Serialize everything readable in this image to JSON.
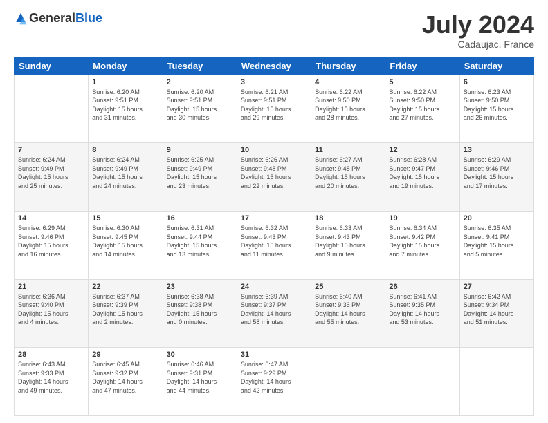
{
  "header": {
    "logo_general": "General",
    "logo_blue": "Blue",
    "month_title": "July 2024",
    "location": "Cadaujac, France"
  },
  "weekdays": [
    "Sunday",
    "Monday",
    "Tuesday",
    "Wednesday",
    "Thursday",
    "Friday",
    "Saturday"
  ],
  "weeks": [
    [
      {
        "day": "",
        "info": ""
      },
      {
        "day": "1",
        "info": "Sunrise: 6:20 AM\nSunset: 9:51 PM\nDaylight: 15 hours\nand 31 minutes."
      },
      {
        "day": "2",
        "info": "Sunrise: 6:20 AM\nSunset: 9:51 PM\nDaylight: 15 hours\nand 30 minutes."
      },
      {
        "day": "3",
        "info": "Sunrise: 6:21 AM\nSunset: 9:51 PM\nDaylight: 15 hours\nand 29 minutes."
      },
      {
        "day": "4",
        "info": "Sunrise: 6:22 AM\nSunset: 9:50 PM\nDaylight: 15 hours\nand 28 minutes."
      },
      {
        "day": "5",
        "info": "Sunrise: 6:22 AM\nSunset: 9:50 PM\nDaylight: 15 hours\nand 27 minutes."
      },
      {
        "day": "6",
        "info": "Sunrise: 6:23 AM\nSunset: 9:50 PM\nDaylight: 15 hours\nand 26 minutes."
      }
    ],
    [
      {
        "day": "7",
        "info": "Sunrise: 6:24 AM\nSunset: 9:49 PM\nDaylight: 15 hours\nand 25 minutes."
      },
      {
        "day": "8",
        "info": "Sunrise: 6:24 AM\nSunset: 9:49 PM\nDaylight: 15 hours\nand 24 minutes."
      },
      {
        "day": "9",
        "info": "Sunrise: 6:25 AM\nSunset: 9:49 PM\nDaylight: 15 hours\nand 23 minutes."
      },
      {
        "day": "10",
        "info": "Sunrise: 6:26 AM\nSunset: 9:48 PM\nDaylight: 15 hours\nand 22 minutes."
      },
      {
        "day": "11",
        "info": "Sunrise: 6:27 AM\nSunset: 9:48 PM\nDaylight: 15 hours\nand 20 minutes."
      },
      {
        "day": "12",
        "info": "Sunrise: 6:28 AM\nSunset: 9:47 PM\nDaylight: 15 hours\nand 19 minutes."
      },
      {
        "day": "13",
        "info": "Sunrise: 6:29 AM\nSunset: 9:46 PM\nDaylight: 15 hours\nand 17 minutes."
      }
    ],
    [
      {
        "day": "14",
        "info": "Sunrise: 6:29 AM\nSunset: 9:46 PM\nDaylight: 15 hours\nand 16 minutes."
      },
      {
        "day": "15",
        "info": "Sunrise: 6:30 AM\nSunset: 9:45 PM\nDaylight: 15 hours\nand 14 minutes."
      },
      {
        "day": "16",
        "info": "Sunrise: 6:31 AM\nSunset: 9:44 PM\nDaylight: 15 hours\nand 13 minutes."
      },
      {
        "day": "17",
        "info": "Sunrise: 6:32 AM\nSunset: 9:43 PM\nDaylight: 15 hours\nand 11 minutes."
      },
      {
        "day": "18",
        "info": "Sunrise: 6:33 AM\nSunset: 9:43 PM\nDaylight: 15 hours\nand 9 minutes."
      },
      {
        "day": "19",
        "info": "Sunrise: 6:34 AM\nSunset: 9:42 PM\nDaylight: 15 hours\nand 7 minutes."
      },
      {
        "day": "20",
        "info": "Sunrise: 6:35 AM\nSunset: 9:41 PM\nDaylight: 15 hours\nand 5 minutes."
      }
    ],
    [
      {
        "day": "21",
        "info": "Sunrise: 6:36 AM\nSunset: 9:40 PM\nDaylight: 15 hours\nand 4 minutes."
      },
      {
        "day": "22",
        "info": "Sunrise: 6:37 AM\nSunset: 9:39 PM\nDaylight: 15 hours\nand 2 minutes."
      },
      {
        "day": "23",
        "info": "Sunrise: 6:38 AM\nSunset: 9:38 PM\nDaylight: 15 hours\nand 0 minutes."
      },
      {
        "day": "24",
        "info": "Sunrise: 6:39 AM\nSunset: 9:37 PM\nDaylight: 14 hours\nand 58 minutes."
      },
      {
        "day": "25",
        "info": "Sunrise: 6:40 AM\nSunset: 9:36 PM\nDaylight: 14 hours\nand 55 minutes."
      },
      {
        "day": "26",
        "info": "Sunrise: 6:41 AM\nSunset: 9:35 PM\nDaylight: 14 hours\nand 53 minutes."
      },
      {
        "day": "27",
        "info": "Sunrise: 6:42 AM\nSunset: 9:34 PM\nDaylight: 14 hours\nand 51 minutes."
      }
    ],
    [
      {
        "day": "28",
        "info": "Sunrise: 6:43 AM\nSunset: 9:33 PM\nDaylight: 14 hours\nand 49 minutes."
      },
      {
        "day": "29",
        "info": "Sunrise: 6:45 AM\nSunset: 9:32 PM\nDaylight: 14 hours\nand 47 minutes."
      },
      {
        "day": "30",
        "info": "Sunrise: 6:46 AM\nSunset: 9:31 PM\nDaylight: 14 hours\nand 44 minutes."
      },
      {
        "day": "31",
        "info": "Sunrise: 6:47 AM\nSunset: 9:29 PM\nDaylight: 14 hours\nand 42 minutes."
      },
      {
        "day": "",
        "info": ""
      },
      {
        "day": "",
        "info": ""
      },
      {
        "day": "",
        "info": ""
      }
    ]
  ]
}
